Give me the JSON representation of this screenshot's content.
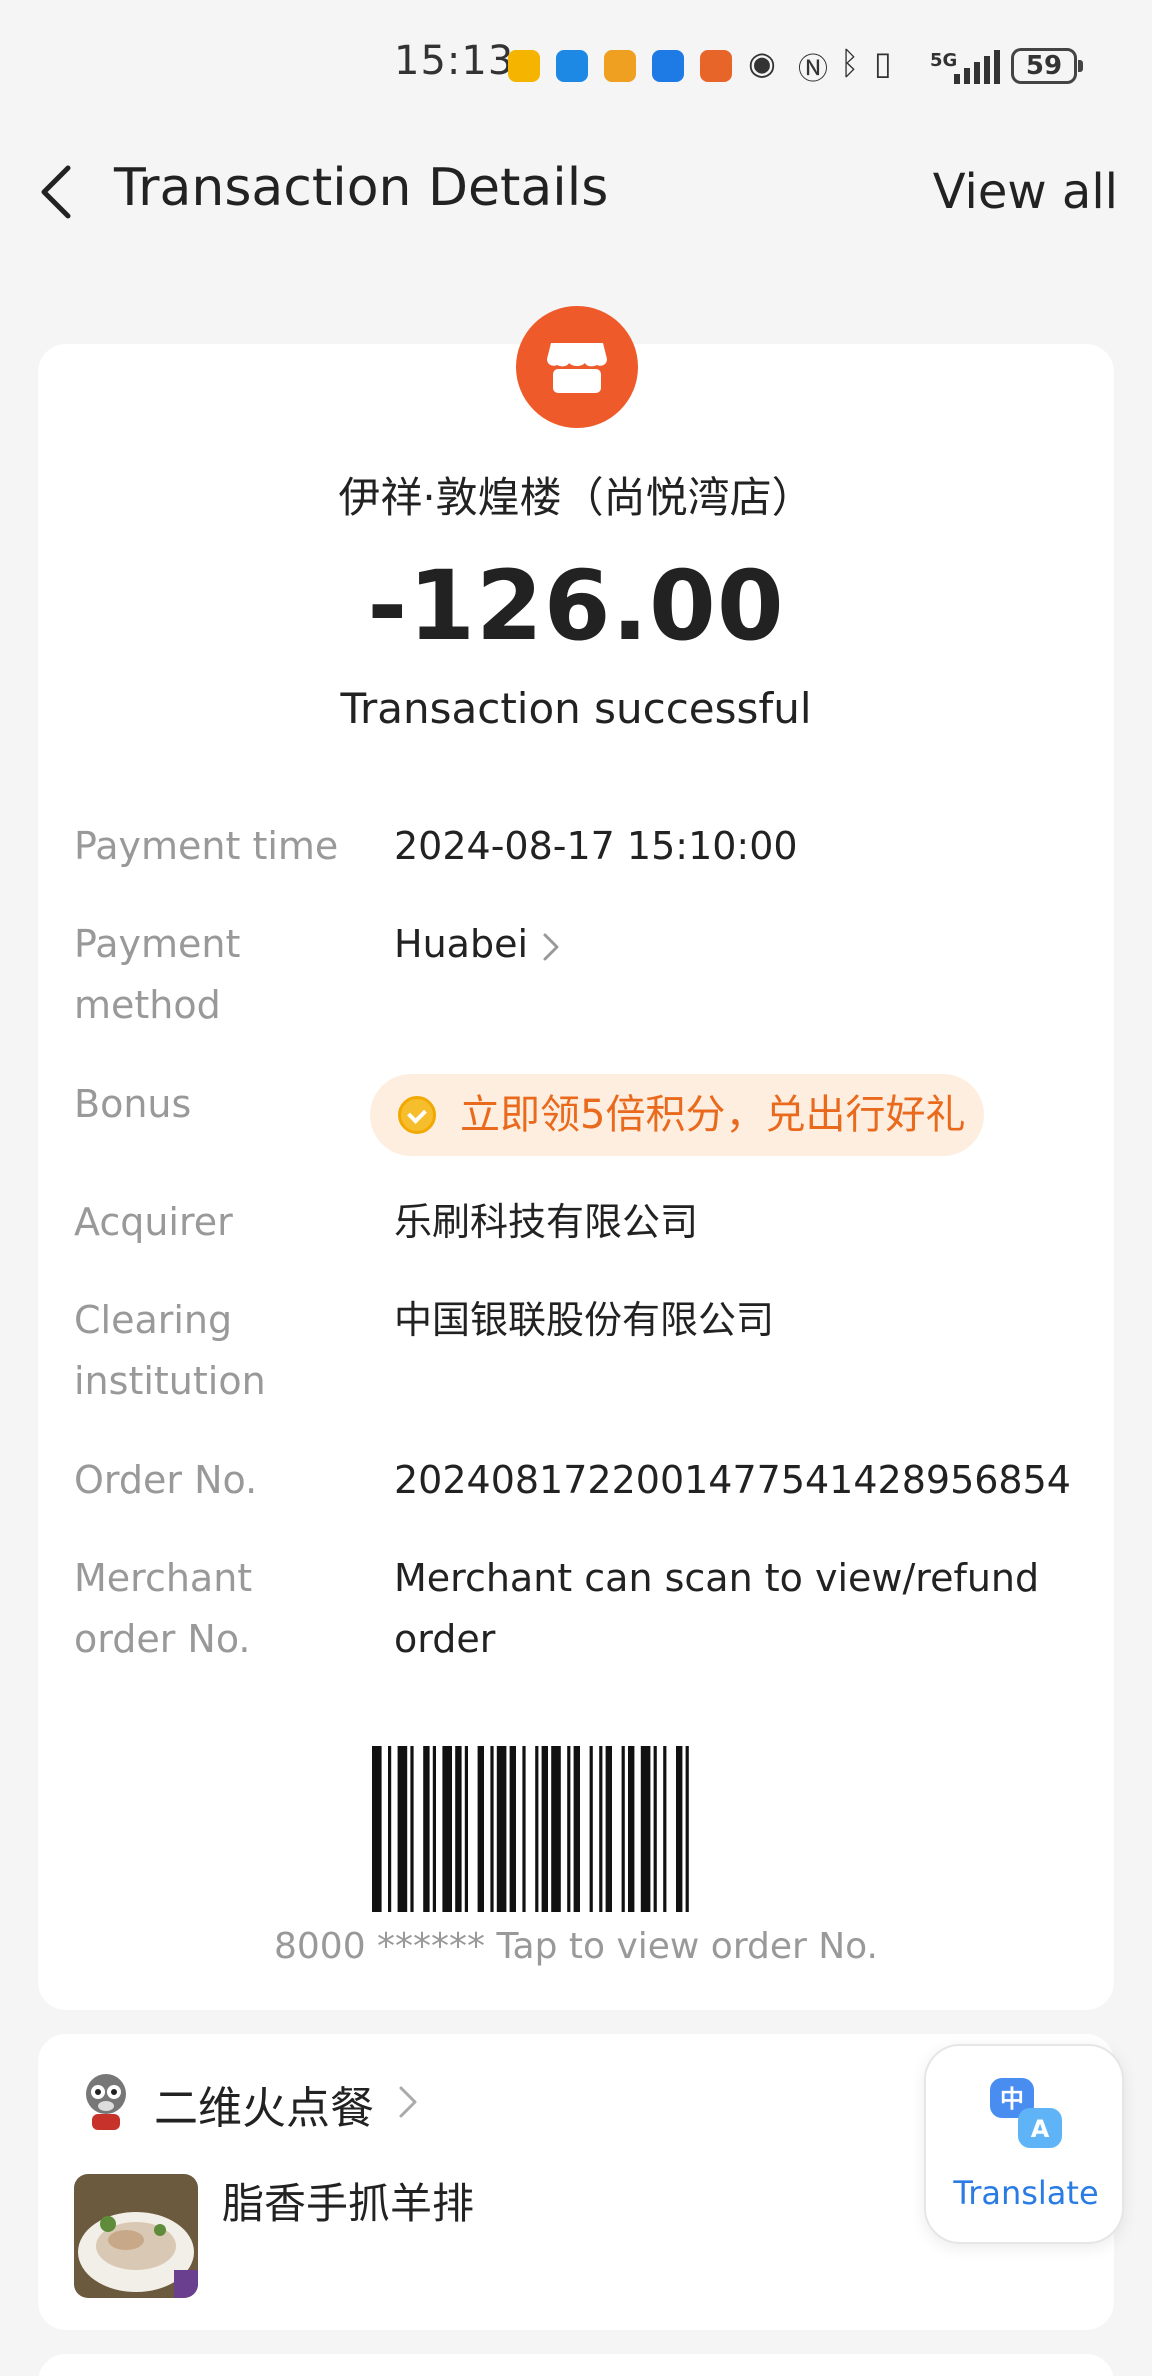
{
  "status_bar": {
    "time": "15:13",
    "network": "5G",
    "battery": "59",
    "icons": [
      "weibo-icon",
      "chat-icon",
      "app-icon",
      "app-icon",
      "app-icon",
      "eye-icon",
      "nfc-icon",
      "bluetooth-icon",
      "vibrate-icon",
      "signal-icon"
    ]
  },
  "header": {
    "title": "Transaction Details",
    "view_all": "View all"
  },
  "transaction": {
    "merchant": "伊祥·敦煌楼（尚悦湾店）",
    "amount": "-126.00",
    "status": "Transaction successful",
    "rows": {
      "payment_time": {
        "label": "Payment time",
        "value": "2024-08-17 15:10:00"
      },
      "payment_method": {
        "label": "Payment method",
        "value": "Huabei"
      },
      "bonus": {
        "label": "Bonus",
        "value": "立即领5倍积分，兑出行好礼"
      },
      "acquirer": {
        "label": "Acquirer",
        "value": "乐刷科技有限公司"
      },
      "clearing": {
        "label": "Clearing institution",
        "value": "中国银联股份有限公司"
      },
      "order_no": {
        "label": "Order No.",
        "value": "2024081722001477541428956854"
      },
      "merchant_order": {
        "label": "Merchant order No.",
        "value": "Merchant can scan to view/refund order"
      }
    },
    "barcode_caption": "8000 ****** Tap to view order No."
  },
  "service": {
    "name": "二维火点餐",
    "dish": "脂香手抓羊排"
  },
  "translate": {
    "label": "Translate"
  },
  "colors": {
    "accent_orange": "#ef5a2a",
    "bonus_text": "#ea6a1d",
    "bonus_bg": "#fdeee0",
    "translate_blue": "#2a7be4"
  }
}
